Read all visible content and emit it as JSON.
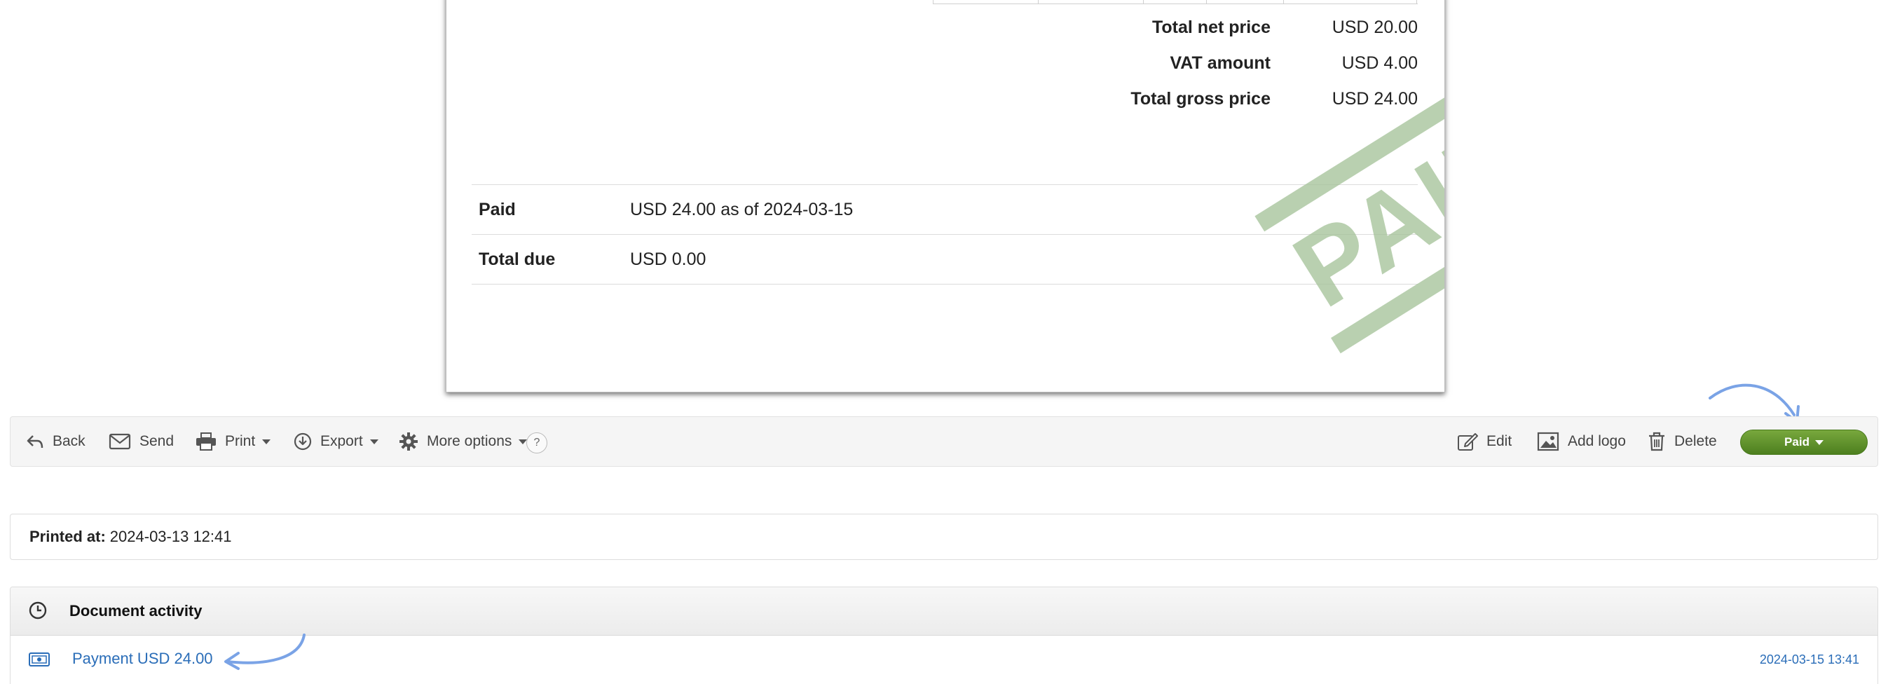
{
  "totals": [
    {
      "label": "Total net price",
      "value": "USD 20.00"
    },
    {
      "label": "VAT amount",
      "value": "USD 4.00"
    },
    {
      "label": "Total gross price",
      "value": "USD 24.00"
    }
  ],
  "payment": {
    "paid_label": "Paid",
    "paid_value": "USD 24.00 as of 2024-03-15",
    "due_label": "Total due",
    "due_value": "USD 0.00"
  },
  "stamp_text": "PAID",
  "toolbar": {
    "back": "Back",
    "send": "Send",
    "print": "Print",
    "export": "Export",
    "more": "More options",
    "help": "?",
    "edit": "Edit",
    "add_logo": "Add logo",
    "delete": "Delete",
    "status": "Paid"
  },
  "printed": {
    "label": "Printed at:",
    "value": "2024-03-13 12:41"
  },
  "activity": {
    "title": "Document activity",
    "items": [
      {
        "label": "Payment USD 24.00",
        "time": "2024-03-15 13:41"
      }
    ]
  },
  "colors": {
    "status_green": "#5f9128",
    "link_blue": "#2a6db8",
    "annotation_blue": "#7aa3e6",
    "stamp_green": "#9fbe94"
  }
}
